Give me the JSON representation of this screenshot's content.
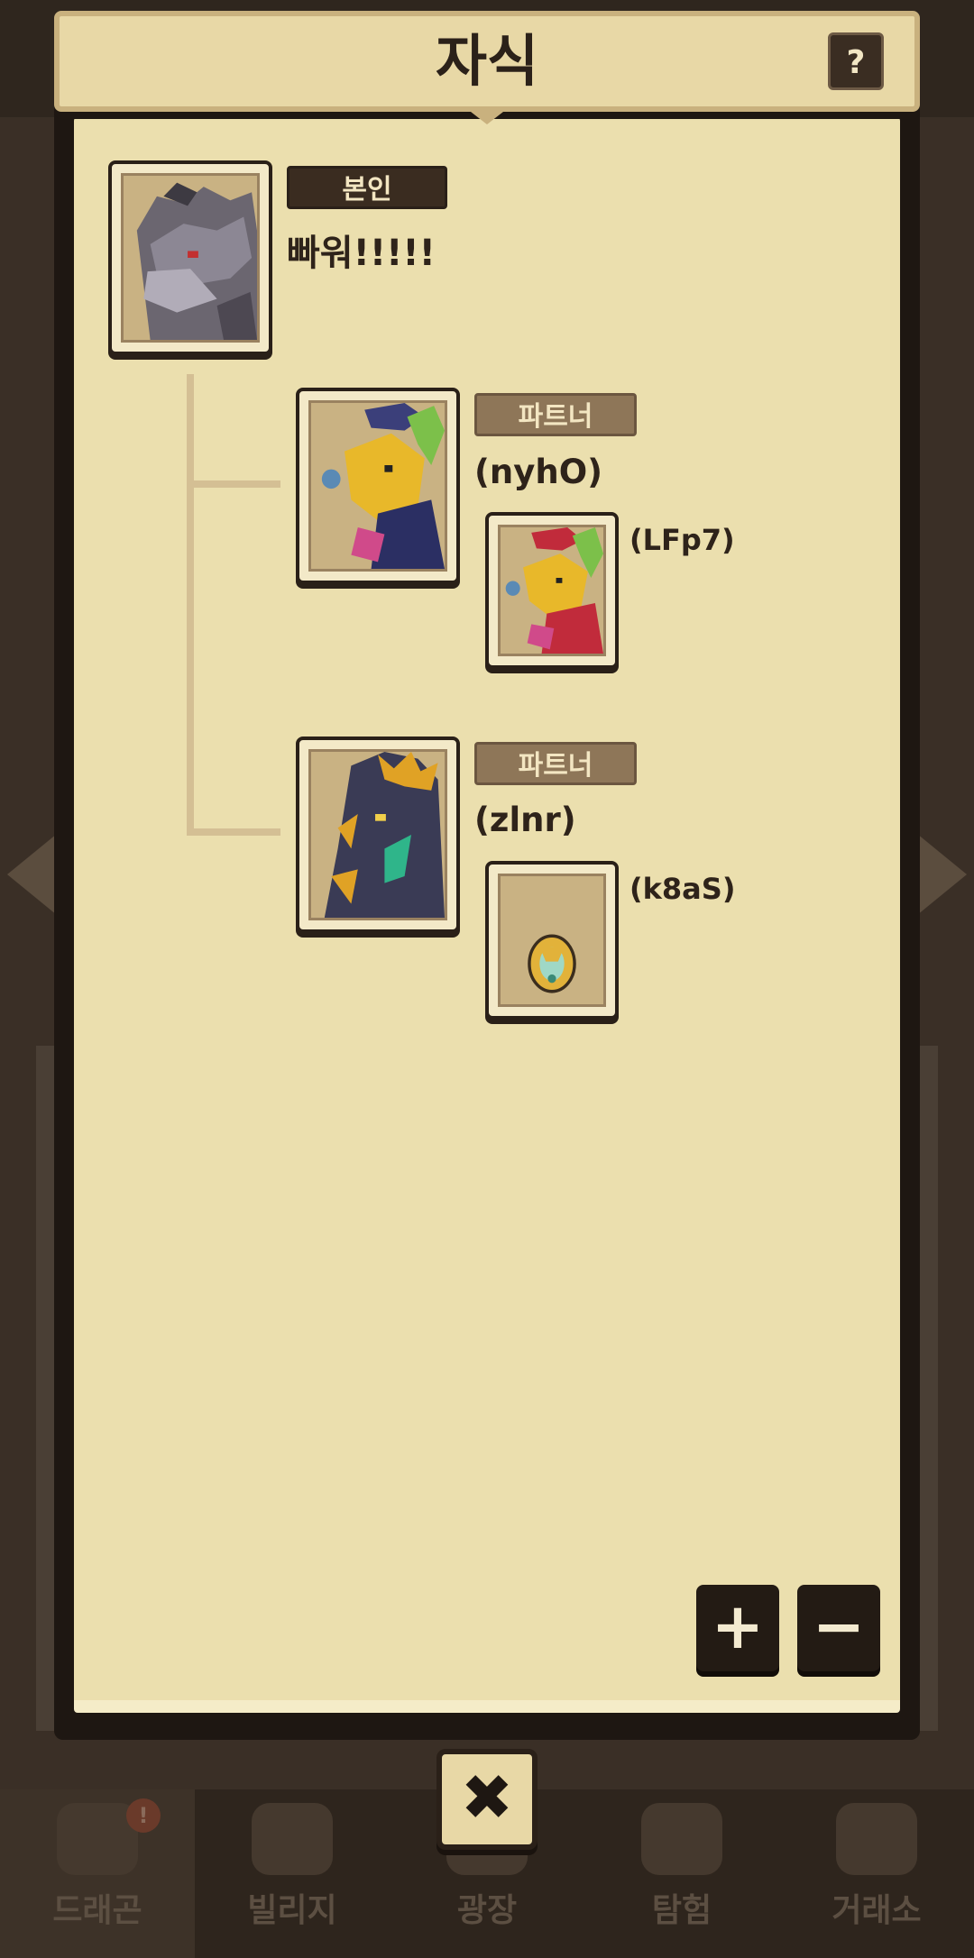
{
  "title": "자식",
  "help_label": "?",
  "close_label": "✖",
  "zoom": {
    "plus": "+",
    "minus": "−"
  },
  "self": {
    "tag": "본인",
    "name": "빠워!!!!!"
  },
  "partners": [
    {
      "tag": "파트너",
      "name": "(nyhO)",
      "child": {
        "name": "(LFp7)",
        "kind": "dragon"
      }
    },
    {
      "tag": "파트너",
      "name": "(zlnr)",
      "child": {
        "name": "(k8aS)",
        "kind": "egg"
      }
    }
  ],
  "bottom_nav": [
    {
      "label": "드래곤",
      "badge": "!"
    },
    {
      "label": "빌리지"
    },
    {
      "label": "광장"
    },
    {
      "label": "탐험"
    },
    {
      "label": "거래소"
    }
  ]
}
